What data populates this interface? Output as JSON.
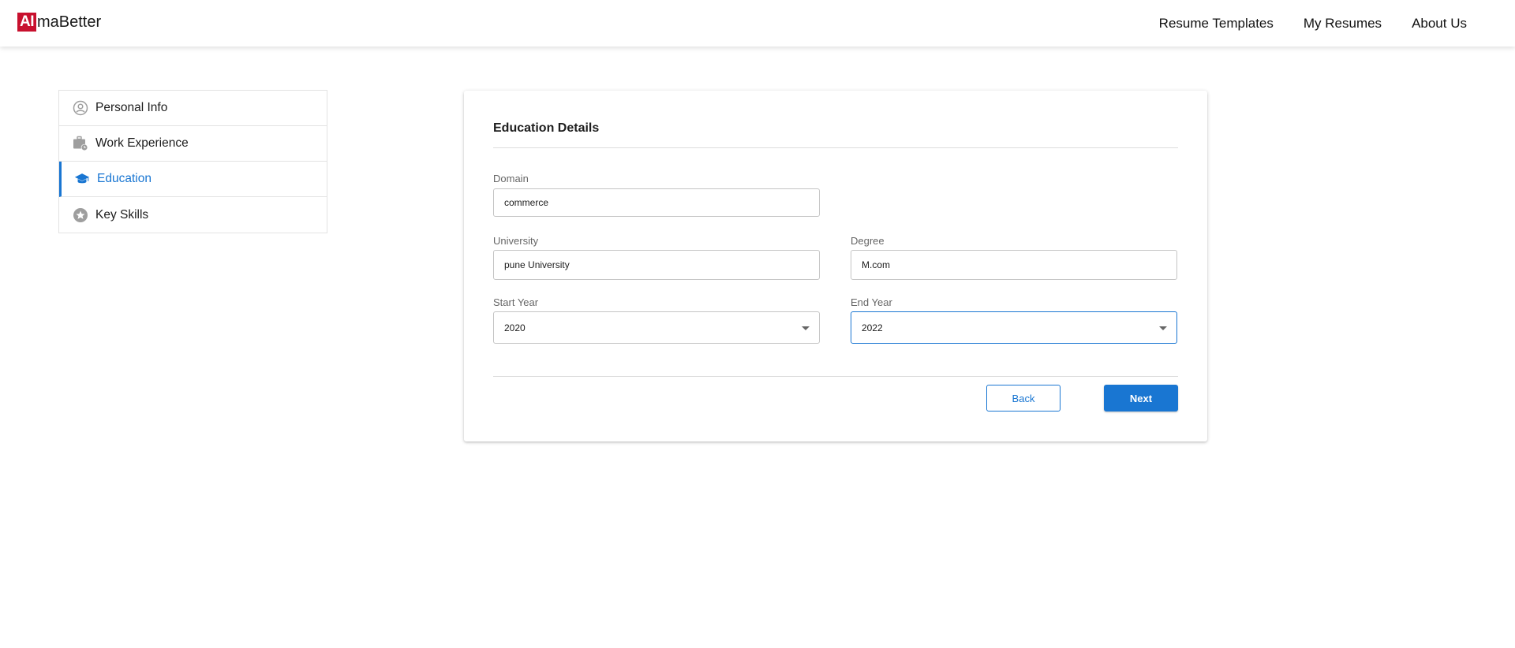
{
  "header": {
    "logo_mark": "AI",
    "logo_word": "maBetter",
    "nav": [
      "Resume Templates",
      "My Resumes",
      "About Us"
    ]
  },
  "sidebar": {
    "items": [
      {
        "label": "Personal Info",
        "icon": "user-circle-icon",
        "active": false
      },
      {
        "label": "Work Experience",
        "icon": "briefcase-clock-icon",
        "active": false
      },
      {
        "label": "Education",
        "icon": "graduation-cap-icon",
        "active": true
      },
      {
        "label": "Key Skills",
        "icon": "star-circle-icon",
        "active": false
      }
    ]
  },
  "form": {
    "title": "Education Details",
    "domain": {
      "label": "Domain",
      "value": "commerce"
    },
    "university": {
      "label": "University",
      "value": "pune University"
    },
    "degree": {
      "label": "Degree",
      "value": "M.com"
    },
    "start_year": {
      "label": "Start Year",
      "value": "2020"
    },
    "end_year": {
      "label": "End Year",
      "value": "2022"
    },
    "back_label": "Back",
    "next_label": "Next"
  },
  "colors": {
    "accent": "#1976d2",
    "brand": "#c8102e"
  }
}
